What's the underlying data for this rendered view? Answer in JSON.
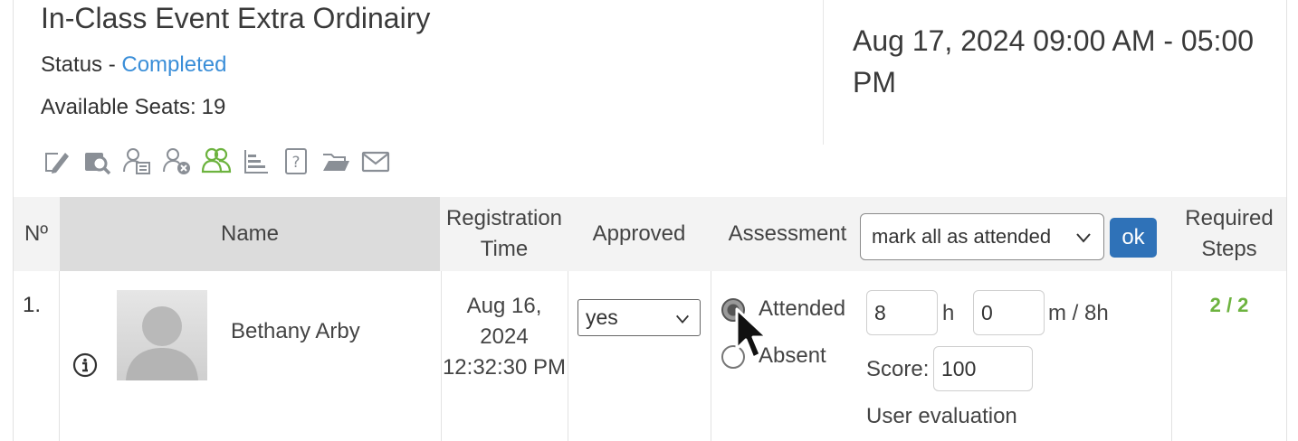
{
  "event": {
    "title": "In-Class Event Extra Ordinairy",
    "status_label": "Status - ",
    "status_value": "Completed",
    "seats_label": "Available Seats:",
    "seats_value": "19",
    "date_range": "Aug 17, 2024 09:00 AM - 05:00 PM"
  },
  "toolbar": {
    "icons": [
      "edit-icon",
      "view-details-icon",
      "user-list-icon",
      "remove-user-icon",
      "users-group-icon",
      "report-icon",
      "question-icon",
      "folder-icon",
      "mail-icon"
    ],
    "active_color": "#6db33f",
    "icon_color": "#8a8f96"
  },
  "table": {
    "headers": {
      "no": "Nº",
      "name": "Name",
      "registration_time": "Registration Time",
      "approved": "Approved",
      "assessment": "Assessment",
      "required_steps": "Required Steps"
    },
    "assessment_select_value": "mark all as attended",
    "ok_label": "ok",
    "rows": [
      {
        "no": "1.",
        "name": "Bethany Arby",
        "registration_time": "Aug 16, 2024 12:32:30 PM",
        "approved": "yes",
        "attended_label": "Attended",
        "absent_label": "Absent",
        "hours": "8",
        "hours_unit": "h",
        "minutes": "0",
        "minutes_unit": "m / 8h",
        "score_label": "Score:",
        "score": "100",
        "user_evaluation": "User evaluation",
        "required_steps": "2 / 2"
      }
    ]
  },
  "colors": {
    "link": "#3a8ed8",
    "button": "#2f72b8",
    "success": "#6db33f"
  }
}
